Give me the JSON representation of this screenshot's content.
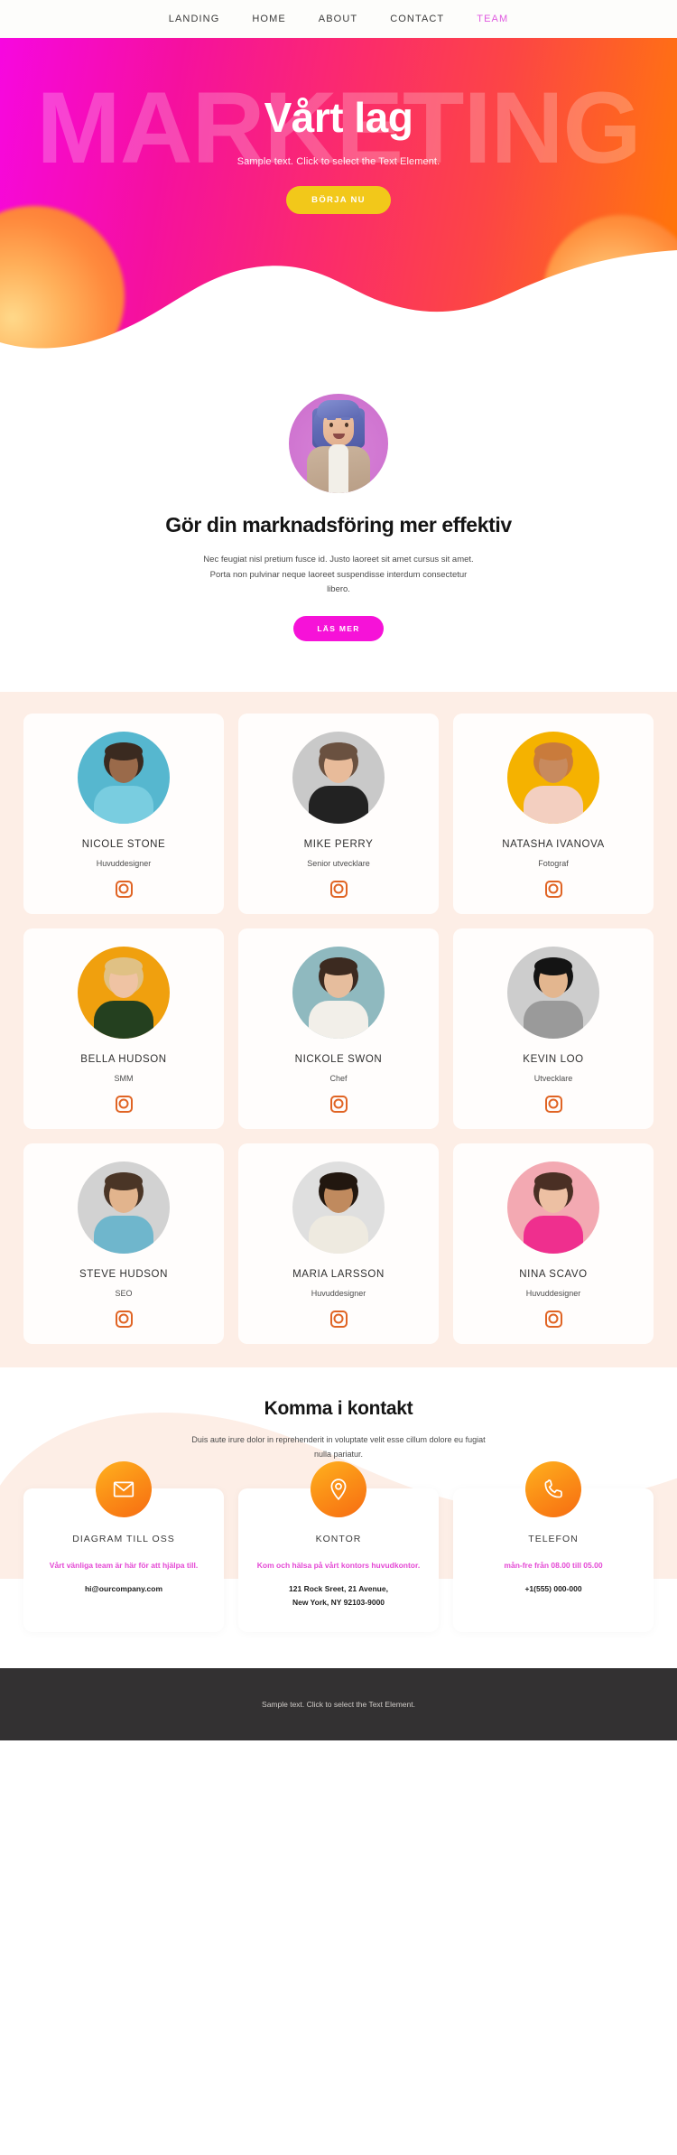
{
  "nav": {
    "items": [
      {
        "label": "LANDING",
        "active": false
      },
      {
        "label": "HOME",
        "active": false
      },
      {
        "label": "ABOUT",
        "active": false
      },
      {
        "label": "CONTACT",
        "active": false
      },
      {
        "label": "TEAM",
        "active": true
      }
    ]
  },
  "hero": {
    "watermark": "MARKETING",
    "title": "Vårt lag",
    "subtitle": "Sample text. Click to select the Text Element.",
    "cta": "BÖRJA NU",
    "cta_color": "#f2c81a",
    "gradient_from": "#f707e0",
    "gradient_to": "#ff7a00"
  },
  "intro": {
    "heading": "Gör din marknadsföring mer effektiv",
    "paragraph": "Nec feugiat nisl pretium fusce id. Justo laoreet sit amet cursus sit amet. Porta non pulvinar neque laoreet suspendisse interdum consectetur libero.",
    "cta": "LÄS MER",
    "cta_color": "#f612d8"
  },
  "team": {
    "background": "#fdeee6",
    "social_icon": "instagram-icon",
    "social_color": "#e06424",
    "members": [
      {
        "name": "NICOLE STONE",
        "role": "Huvuddesigner",
        "bg": "#56b7cf",
        "skin": "#9a6a4a",
        "hair": "#3a2a20",
        "outfit": "#79cde0"
      },
      {
        "name": "MIKE PERRY",
        "role": "Senior utvecklare",
        "bg": "#c9c9c9",
        "skin": "#e8bb9a",
        "hair": "#6a5140",
        "outfit": "#222222"
      },
      {
        "name": "NATASHA IVANOVA",
        "role": "Fotograf",
        "bg": "#f5b200",
        "skin": "#c88a5e",
        "hair": "#c97b3c",
        "outfit": "#f3cfc0"
      },
      {
        "name": "BELLA HUDSON",
        "role": "SMM",
        "bg": "#f0a00e",
        "skin": "#efc3a3",
        "hair": "#e0c184",
        "outfit": "#24401f"
      },
      {
        "name": "NICKOLE SWON",
        "role": "Chef",
        "bg": "#8fb9bf",
        "skin": "#e6bd9d",
        "hair": "#3c2a20",
        "outfit": "#f2efe9"
      },
      {
        "name": "KEVIN LOO",
        "role": "Utvecklare",
        "bg": "#cdcdcd",
        "skin": "#e3b68f",
        "hair": "#141414",
        "outfit": "#9a9a9a"
      },
      {
        "name": "STEVE HUDSON",
        "role": "SEO",
        "bg": "#d2d2d2",
        "skin": "#e2b48d",
        "hair": "#4a3526",
        "outfit": "#6fb6cc"
      },
      {
        "name": "MARIA LARSSON",
        "role": "Huvuddesigner",
        "bg": "#dfdfdf",
        "skin": "#c08a5e",
        "hair": "#22170f",
        "outfit": "#eeeae0"
      },
      {
        "name": "NINA SCAVO",
        "role": "Huvuddesigner",
        "bg": "#f3a9b2",
        "skin": "#edc0a3",
        "hair": "#4a2f24",
        "outfit": "#ef2f8e"
      }
    ]
  },
  "contact": {
    "heading": "Komma i kontakt",
    "lede": "Duis aute irure dolor in reprehenderit in voluptate velit esse cillum dolore eu fugiat nulla pariatur.",
    "cards": [
      {
        "icon": "envelope-icon",
        "title": "DIAGRAM TILL OSS",
        "desc": "Vårt vänliga team är här för att hjälpa till.",
        "value": "hi@ourcompany.com"
      },
      {
        "icon": "map-pin-icon",
        "title": "KONTOR",
        "desc": "Kom och hälsa på vårt kontors huvudkontor.",
        "value": "121 Rock Sreet, 21 Avenue,\nNew York, NY 92103-9000"
      },
      {
        "icon": "phone-icon",
        "title": "TELEFON",
        "desc": "mån-fre från 08.00 till 05.00",
        "value": "+1(555) 000-000"
      }
    ],
    "accent_color": "#e448d4",
    "icon_gradient_from": "#ffb21f",
    "icon_gradient_to": "#f76c12"
  },
  "footer": {
    "text": "Sample text. Click to select the Text Element.",
    "background": "#333132"
  }
}
